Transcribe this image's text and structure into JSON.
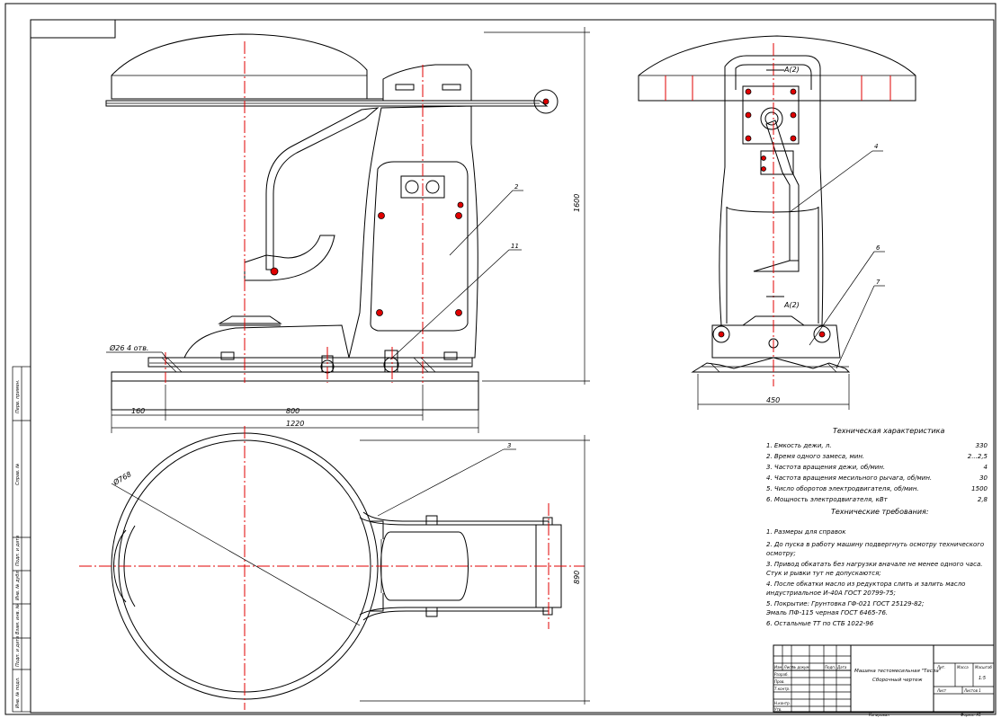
{
  "dimensions": {
    "hole_note": "Ø26 4 отв.",
    "d160": "160",
    "d800": "800",
    "d1220": "1220",
    "d1600": "1600",
    "d450": "450",
    "diam_plan": "Ø768",
    "d890": "890"
  },
  "callouts": {
    "c2": "2",
    "c11": "11",
    "c4": "4",
    "c6": "6",
    "c7": "7",
    "c3": "3"
  },
  "section_marks": {
    "top": "A(2)",
    "bottom": "A(2)"
  },
  "tech_specs": {
    "title": "Техническая характеристика",
    "rows": [
      {
        "label": "1. Емкость дежи, л.",
        "value": "330"
      },
      {
        "label": "2. Время одного замеса, мин.",
        "value": "2...2,5"
      },
      {
        "label": "3. Частота вращения дежи, об/мин.",
        "value": "4"
      },
      {
        "label": "4. Частота вращения месильного рычага, об/мин.",
        "value": "30"
      },
      {
        "label": "5. Число оборотов электродвигателя, об/мин.",
        "value": "1500"
      },
      {
        "label": "6. Мощность электродвигателя, кВт",
        "value": "2,8"
      }
    ]
  },
  "tech_req": {
    "title": "Технические требования:",
    "lines": [
      "1. Размеры для справок",
      "2. До пуска в работу машину подвергнуть осмотру технического",
      "   осмотру;",
      "3. Привод обкатать без нагрузки вначале не менее одного часа.",
      "   Стук и рывки тут не допускаются;",
      "4. После обкатки масло из редуктора слить и залить масло",
      "   индустриальное И-40А ГОСТ 20799-75;",
      "5. Покрытие: Грунтовка ГФ-021 ГОСТ 25129-82;",
      "   Эмаль ПФ-115 черная ГОСТ 6465-76.",
      "6. Остальные ТТ по СТБ 1022-96"
    ]
  },
  "title_block": {
    "name_line1": "Машина тестомесильная \"Тесла\"",
    "name_line2": "Сборочный чертеж",
    "col_mass": "Масса",
    "col_scale": "Масштаб",
    "scale": "1:5",
    "sheet": "Лист",
    "sheets": "Листов 1",
    "stage": "Лит.",
    "bottom_copy": "Копировал",
    "bottom_format": "Формат А1",
    "razrab": "Разраб.",
    "prov": "Пров.",
    "tkontr": "Т.контр.",
    "nkontr": "Н.контр.",
    "utv": "Утв.",
    "izm": "Изм. Лист",
    "ndokum": "№ докум.",
    "podp": "Подп.",
    "data": "Дата"
  },
  "side_strip": {
    "s1": "Перв. примен.",
    "s2": "Справ. №",
    "s3": "Подп. и дата",
    "s4": "Инв. № дубл.",
    "s5": "Взам. инв. №",
    "s6": "Подп. и дата",
    "s7": "Инв. № подл."
  }
}
